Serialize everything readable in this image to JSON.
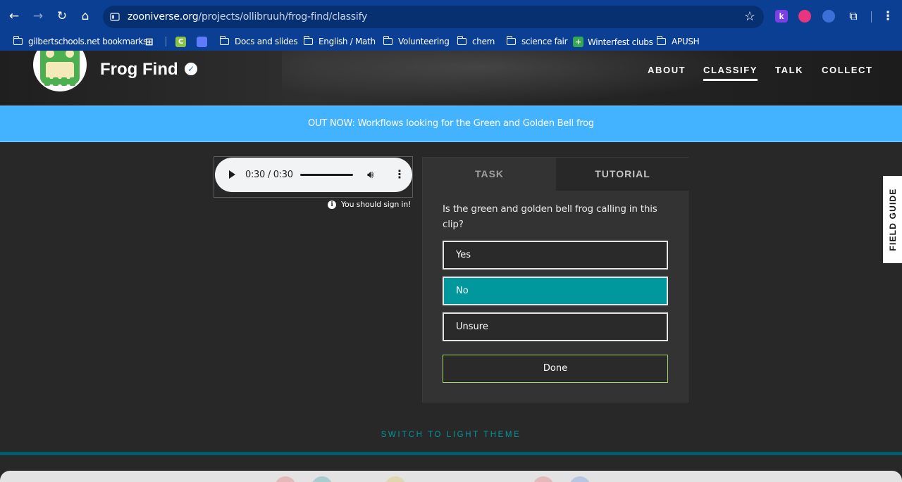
{
  "browser": {
    "url_host": "zooniverse.org",
    "url_path": "/projects/ollibruuh/frog-find/classify",
    "bookmarks": [
      {
        "label": "gilbertschools.net bookmarks",
        "type": "managed"
      },
      {
        "label": "Docs and slides",
        "type": "folder"
      },
      {
        "label": "English / Math",
        "type": "folder"
      },
      {
        "label": "Volunteering",
        "type": "folder"
      },
      {
        "label": "chem",
        "type": "folder"
      },
      {
        "label": "science fair",
        "type": "folder"
      },
      {
        "label": "Winterfest clubs",
        "type": "site"
      },
      {
        "label": "APUSH",
        "type": "folder"
      }
    ]
  },
  "header": {
    "project_title": "Frog Find",
    "nav": [
      {
        "label": "ABOUT",
        "active": false
      },
      {
        "label": "CLASSIFY",
        "active": true
      },
      {
        "label": "TALK",
        "active": false
      },
      {
        "label": "COLLECT",
        "active": false
      }
    ]
  },
  "announcement": "OUT NOW: Workflows looking for the Green and Golden Bell frog",
  "audio": {
    "time": "0:30 / 0:30"
  },
  "signin_notice": "You should sign in!",
  "task": {
    "tabs": [
      "TASK",
      "TUTORIAL"
    ],
    "question": "Is the green and golden bell frog calling in this clip?",
    "answers": [
      {
        "label": "Yes",
        "selected": false
      },
      {
        "label": "No",
        "selected": true
      },
      {
        "label": "Unsure",
        "selected": false
      }
    ],
    "done_label": "Done"
  },
  "field_guide_label": "FIELD GUIDE",
  "theme_switch_label": "SWITCH TO LIGHT THEME",
  "colors": {
    "accent_teal": "#00979d",
    "announcement_blue": "#43b3ff",
    "done_border": "#a6d96a"
  }
}
